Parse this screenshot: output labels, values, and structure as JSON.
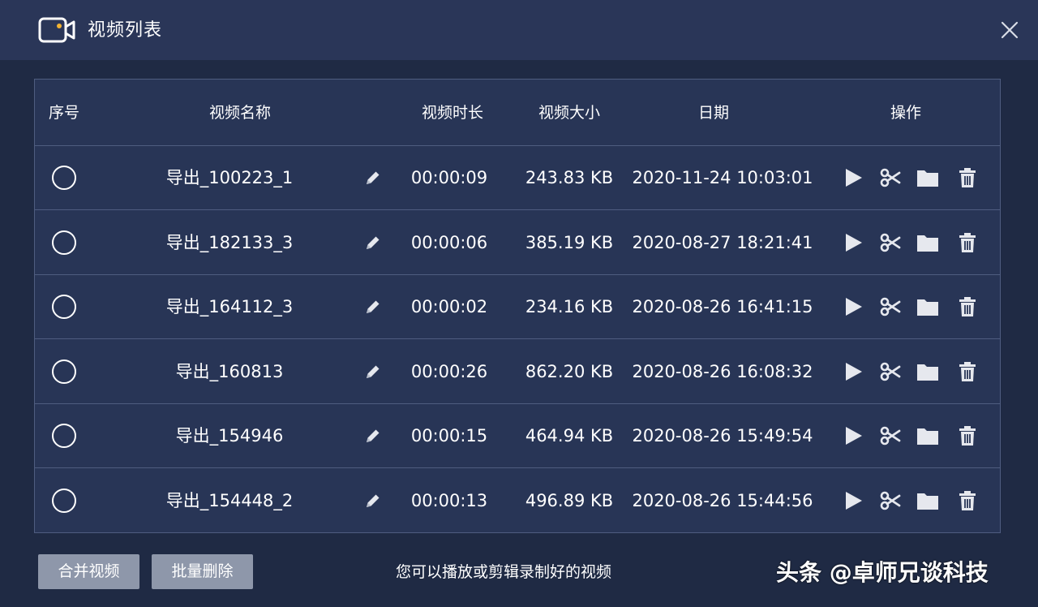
{
  "window": {
    "title": "视频列表",
    "icons": {
      "app": "video-camera-icon",
      "close": "close-icon"
    }
  },
  "table": {
    "headers": {
      "index": "序号",
      "name": "视频名称",
      "duration": "视频时长",
      "size": "视频大小",
      "date": "日期",
      "actions": "操作"
    },
    "row_icons": [
      "edit-pencil-icon",
      "play-icon",
      "scissors-icon",
      "folder-icon",
      "trash-icon"
    ],
    "rows": [
      {
        "name": "导出_100223_1",
        "duration": "00:00:09",
        "size": "243.83 KB",
        "date": "2020-11-24 10:03:01"
      },
      {
        "name": "导出_182133_3",
        "duration": "00:00:06",
        "size": "385.19 KB",
        "date": "2020-08-27 18:21:41"
      },
      {
        "name": "导出_164112_3",
        "duration": "00:00:02",
        "size": "234.16 KB",
        "date": "2020-08-26 16:41:15"
      },
      {
        "name": "导出_160813",
        "duration": "00:00:26",
        "size": "862.20 KB",
        "date": "2020-08-26 16:08:32"
      },
      {
        "name": "导出_154946",
        "duration": "00:00:15",
        "size": "464.94 KB",
        "date": "2020-08-26 15:49:54"
      },
      {
        "name": "导出_154448_2",
        "duration": "00:00:13",
        "size": "496.89 KB",
        "date": "2020-08-26 15:44:56"
      }
    ]
  },
  "footer": {
    "merge_label": "合并视频",
    "batch_delete_label": "批量删除",
    "hint": "您可以播放或剪辑录制好的视频"
  },
  "watermark": "头条 @卓师兄谈科技",
  "colors": {
    "background": "#1f2a44",
    "titlebar": "#2a3658",
    "table": "#283556",
    "border": "#4f5d80",
    "button": "#8e97aa",
    "icon": "#e6e8ee"
  }
}
